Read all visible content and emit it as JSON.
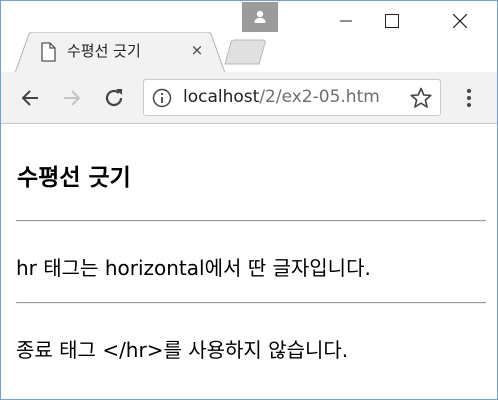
{
  "browser": {
    "tab": {
      "title": "수평선 긋기",
      "close_glyph": "×"
    },
    "window_controls": [
      "minimize",
      "maximize",
      "close"
    ],
    "address_bar": {
      "host": "localhost",
      "path": "/2/ex2-05.htm"
    },
    "icons": {
      "profile": "person-icon",
      "tab": "page-document-icon",
      "back": "arrow-left-icon",
      "forward": "arrow-right-icon",
      "reload": "reload-icon",
      "info": "info-icon",
      "bookmark": "star-icon",
      "menu": "vertical-dots-icon"
    }
  },
  "page": {
    "heading": "수평선 긋기",
    "paragraph_1": "hr 태그는 horizontal에서 딴 글자입니다.",
    "paragraph_2": "종료 태그 </hr>를 사용하지 않습니다."
  }
}
